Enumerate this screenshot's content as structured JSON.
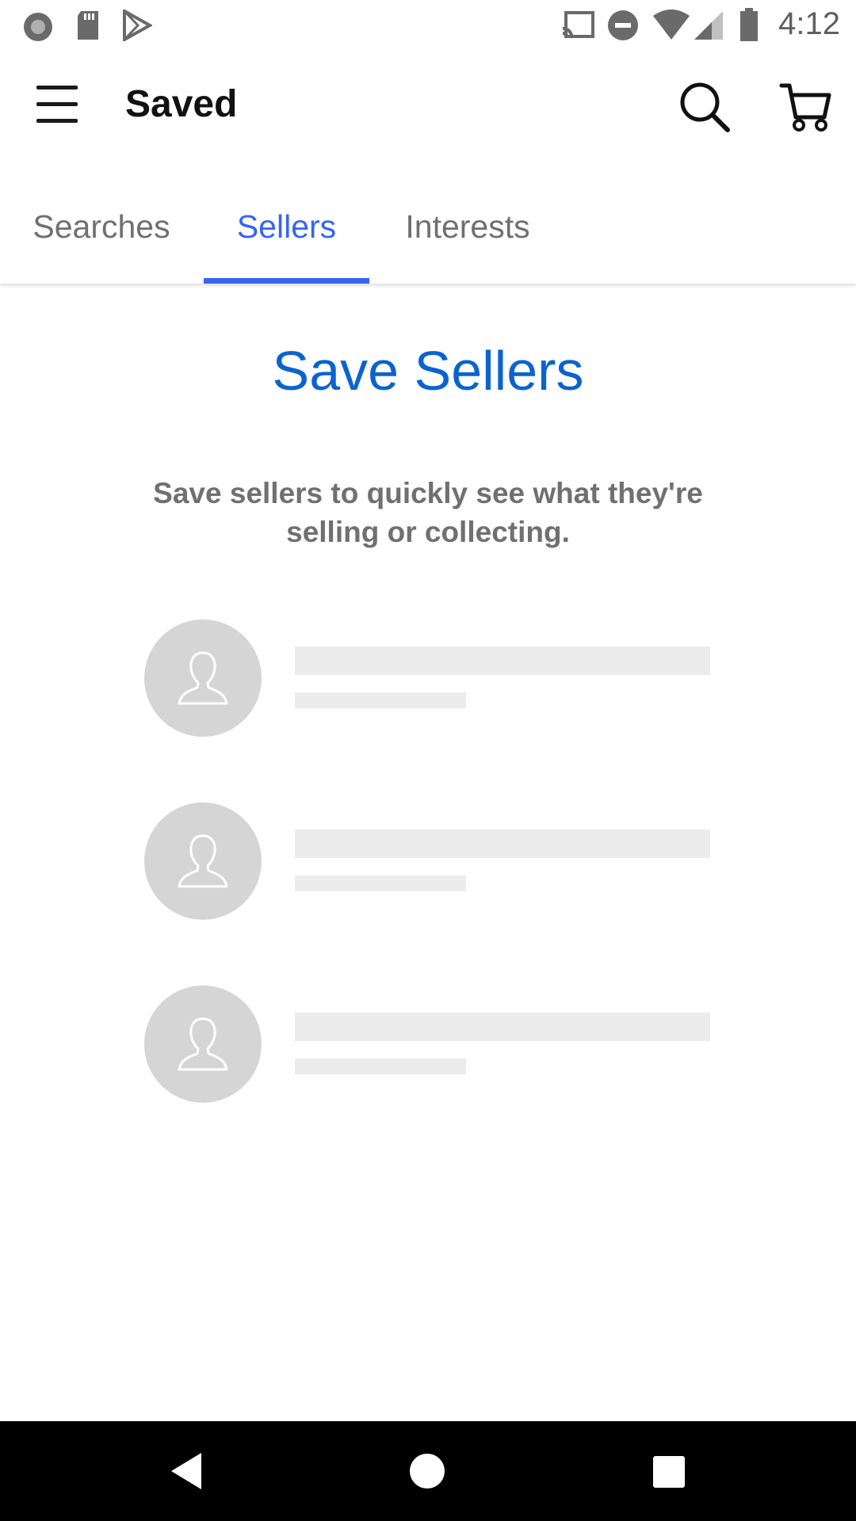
{
  "status_bar": {
    "time": "4:12",
    "left_icons": [
      "record-icon",
      "sd-card-icon",
      "play-store-icon"
    ],
    "right_icons": [
      "cast-icon",
      "do-not-disturb-icon",
      "wifi-icon",
      "signal-icon",
      "battery-icon"
    ]
  },
  "app_bar": {
    "title": "Saved",
    "icons": [
      "menu-icon",
      "search-icon",
      "cart-icon"
    ]
  },
  "tabs": [
    {
      "label": "Searches",
      "active": false
    },
    {
      "label": "Sellers",
      "active": true
    },
    {
      "label": "Interests",
      "active": false
    }
  ],
  "main": {
    "heading": "Save Sellers",
    "description": "Save sellers to quickly see what they're selling or collecting.",
    "placeholder_rows": 3
  },
  "nav_bar": {
    "icons": [
      "back-icon",
      "home-icon",
      "recents-icon"
    ]
  },
  "colors": {
    "accent": "#3665f3",
    "heading": "#0b63ce",
    "muted_text": "#707070",
    "placeholder": "#ececec",
    "avatar_bg": "#d5d5d5"
  }
}
